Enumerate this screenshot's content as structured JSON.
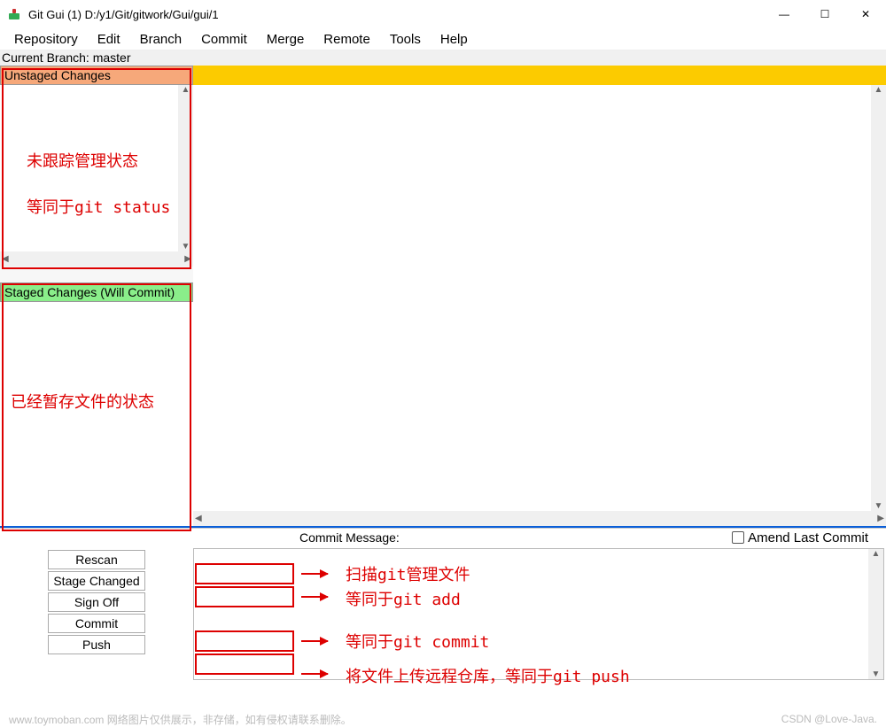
{
  "title": "Git Gui (1) D:/y1/Git/gitwork/Gui/gui/1",
  "menu": [
    "Repository",
    "Edit",
    "Branch",
    "Commit",
    "Merge",
    "Remote",
    "Tools",
    "Help"
  ],
  "branch_label": "Current Branch: master",
  "panels": {
    "unstaged": "Unstaged Changes",
    "staged": "Staged Changes (Will Commit)"
  },
  "commit": {
    "label": "Commit Message:",
    "amend": "Amend Last Commit"
  },
  "buttons": {
    "rescan": "Rescan",
    "stage": "Stage Changed",
    "signoff": "Sign Off",
    "commit": "Commit",
    "push": "Push"
  },
  "annotations": {
    "unstaged_1": "未跟踪管理状态",
    "unstaged_2": "等同于git status",
    "staged": "已经暂存文件的状态",
    "rescan": "扫描git管理文件",
    "stage": "等同于git add",
    "commit": "等同于git commit",
    "push": "将文件上传远程仓库，等同于git push"
  },
  "footer": {
    "left": "www.toymoban.com  网络图片仅供展示，非存储，如有侵权请联系删除。",
    "right": "CSDN @Love-Java."
  },
  "glyphs": {
    "min": "—",
    "max": "☐",
    "close": "✕",
    "up": "▲",
    "down": "▼",
    "left": "◀",
    "right": "▶"
  }
}
